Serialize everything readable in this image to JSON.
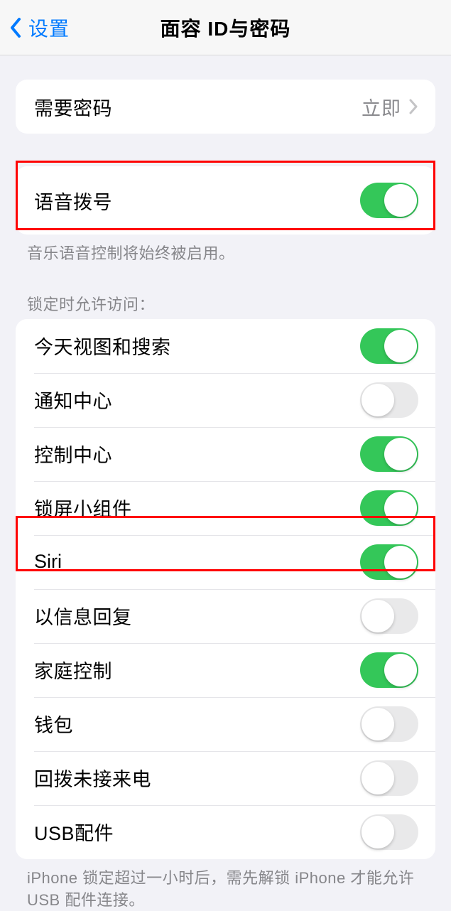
{
  "header": {
    "back_label": "设置",
    "title": "面容 ID与密码"
  },
  "section1": {
    "require_passcode": {
      "label": "需要密码",
      "value": "立即"
    }
  },
  "section2": {
    "voice_dial": {
      "label": "语音拨号",
      "enabled": true
    },
    "footer": "音乐语音控制将始终被启用。"
  },
  "section3": {
    "header": "锁定时允许访问：",
    "items": [
      {
        "label": "今天视图和搜索",
        "enabled": true
      },
      {
        "label": "通知中心",
        "enabled": false
      },
      {
        "label": "控制中心",
        "enabled": true
      },
      {
        "label": "锁屏小组件",
        "enabled": true
      },
      {
        "label": "Siri",
        "enabled": true
      },
      {
        "label": "以信息回复",
        "enabled": false
      },
      {
        "label": "家庭控制",
        "enabled": true
      },
      {
        "label": "钱包",
        "enabled": false
      },
      {
        "label": "回拨未接来电",
        "enabled": false
      },
      {
        "label": "USB配件",
        "enabled": false
      }
    ],
    "footer": "iPhone 锁定超过一小时后，需先解锁 iPhone 才能允许USB 配件连接。"
  }
}
